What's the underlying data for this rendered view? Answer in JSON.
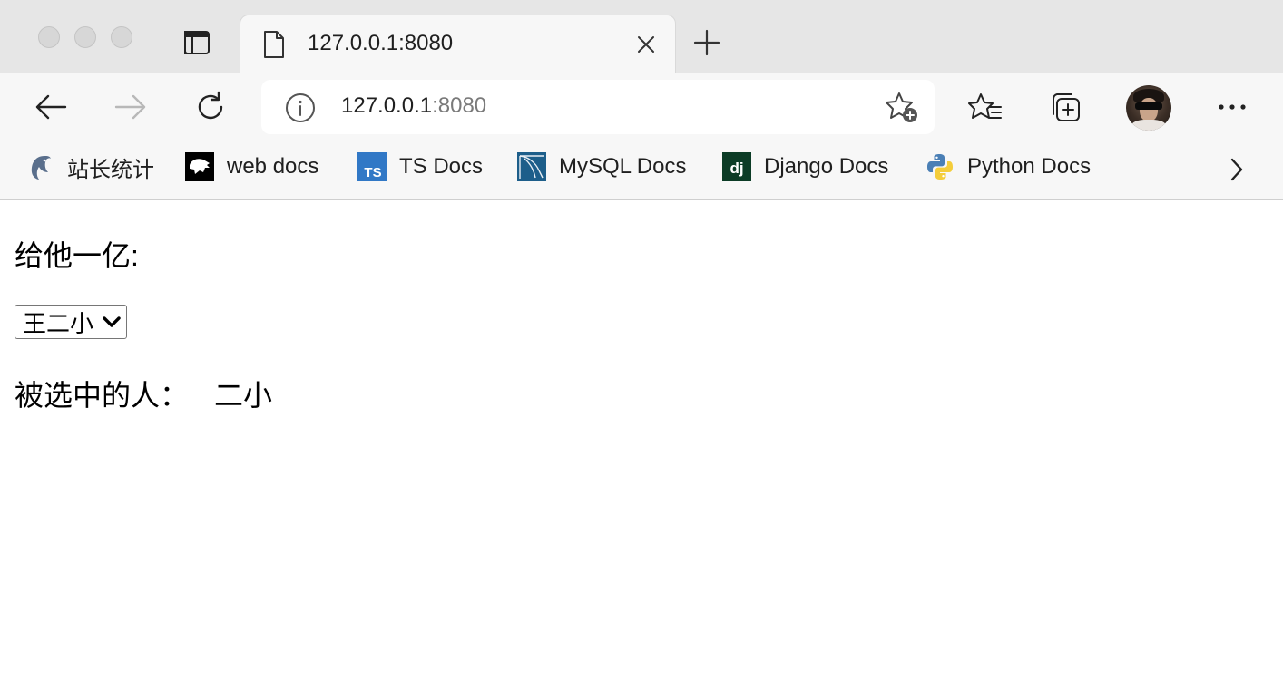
{
  "browser": {
    "tab": {
      "title": "127.0.0.1:8080"
    },
    "address": {
      "host": "127.0.0.1",
      "port": ":8080"
    },
    "bookmarks": [
      {
        "label": "站长统计",
        "icon": "dolphin-icon"
      },
      {
        "label": "web docs",
        "icon": "mdn-dino-icon"
      },
      {
        "label": "TS Docs",
        "icon": "typescript-icon"
      },
      {
        "label": "MySQL Docs",
        "icon": "mysql-icon"
      },
      {
        "label": "Django Docs",
        "icon": "django-icon"
      },
      {
        "label": "Python Docs",
        "icon": "python-icon"
      }
    ],
    "colors": {
      "tabstrip": "#e6e6e6",
      "toolbar": "#f7f7f7",
      "ts_blue": "#3178c6",
      "django_green": "#0c3c26",
      "mysql_blue": "#1d5e8a"
    }
  },
  "page": {
    "heading": "给他一亿:",
    "select": {
      "value": "王二小"
    },
    "selected_label": "被选中的人：",
    "selected_value": "二小"
  }
}
